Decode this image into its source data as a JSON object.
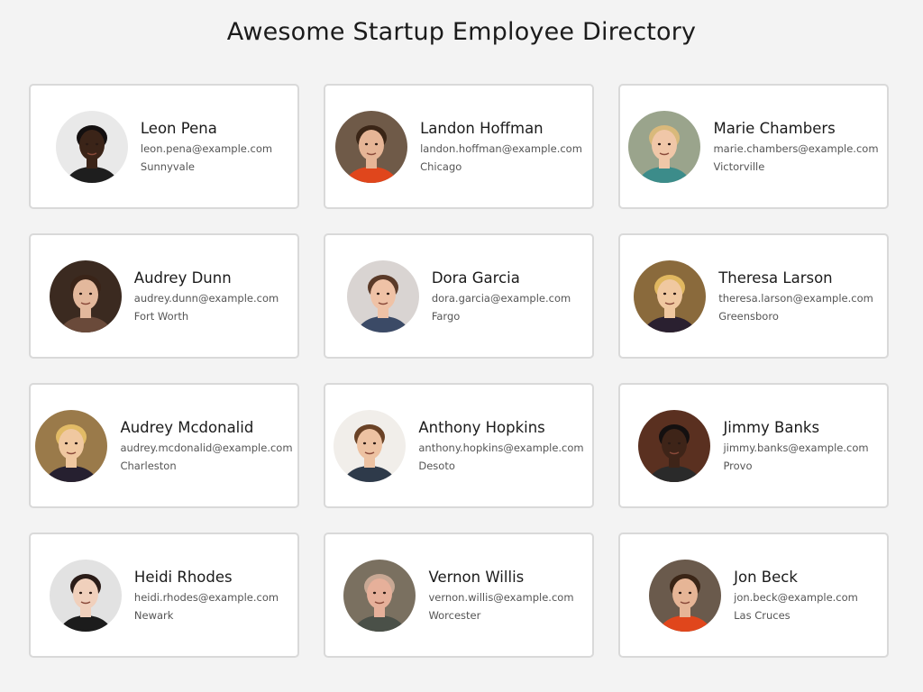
{
  "title": "Awesome Startup Employee Directory",
  "employees": [
    {
      "name": "Leon Pena",
      "email": "leon.pena@example.com",
      "city": "Sunnyvale",
      "bg": "#e9e9e9",
      "skin": "#3b2418",
      "hair": "#141010",
      "shirt": "#1e1e1e"
    },
    {
      "name": "Landon Hoffman",
      "email": "landon.hoffman@example.com",
      "city": "Chicago",
      "bg": "#6f5a48",
      "skin": "#e6b596",
      "hair": "#3a2516",
      "shirt": "#e0461c"
    },
    {
      "name": "Marie Chambers",
      "email": "marie.chambers@example.com",
      "city": "Victorville",
      "bg": "#9aa48c",
      "skin": "#f0c7a8",
      "hair": "#d9b97b",
      "shirt": "#3c8c8a"
    },
    {
      "name": "Audrey Dunn",
      "email": "audrey.dunn@example.com",
      "city": "Fort Worth",
      "bg": "#3b2a20",
      "skin": "#e3b89c",
      "hair": "#3a2418",
      "shirt": "#6a4a3a"
    },
    {
      "name": "Dora Garcia",
      "email": "dora.garcia@example.com",
      "city": "Fargo",
      "bg": "#d9d4d2",
      "skin": "#efc2a6",
      "hair": "#5a3a28",
      "shirt": "#3b4a66"
    },
    {
      "name": "Theresa Larson",
      "email": "theresa.larson@example.com",
      "city": "Greensboro",
      "bg": "#8a6a3c",
      "skin": "#f0c8a0",
      "hair": "#e1b860",
      "shirt": "#2a2030"
    },
    {
      "name": "Audrey Mcdonalid",
      "email": "audrey.mcdonalid@example.com",
      "city": "Charleston",
      "bg": "#9a7a4a",
      "skin": "#f0c8a0",
      "hair": "#e2bb66",
      "shirt": "#262030"
    },
    {
      "name": "Anthony Hopkins",
      "email": "anthony.hopkins@example.com",
      "city": "Desoto",
      "bg": "#f1eeea",
      "skin": "#edc2a2",
      "hair": "#6a4226",
      "shirt": "#2e3a4a"
    },
    {
      "name": "Jimmy Banks",
      "email": "jimmy.banks@example.com",
      "city": "Provo",
      "bg": "#5a3020",
      "skin": "#3e2418",
      "hair": "#141010",
      "shirt": "#2a2a2a"
    },
    {
      "name": "Heidi Rhodes",
      "email": "heidi.rhodes@example.com",
      "city": "Newark",
      "bg": "#e2e2e2",
      "skin": "#f0d0bc",
      "hair": "#2a1c18",
      "shirt": "#1c1c1c"
    },
    {
      "name": "Vernon Willis",
      "email": "vernon.willis@example.com",
      "city": "Worcester",
      "bg": "#7a7060",
      "skin": "#e6b09a",
      "hair": "#c8a894",
      "shirt": "#4a5048"
    },
    {
      "name": "Jon Beck",
      "email": "jon.beck@example.com",
      "city": "Las Cruces",
      "bg": "#6a5a4c",
      "skin": "#e6b596",
      "hair": "#3a2516",
      "shirt": "#e0461c"
    }
  ]
}
